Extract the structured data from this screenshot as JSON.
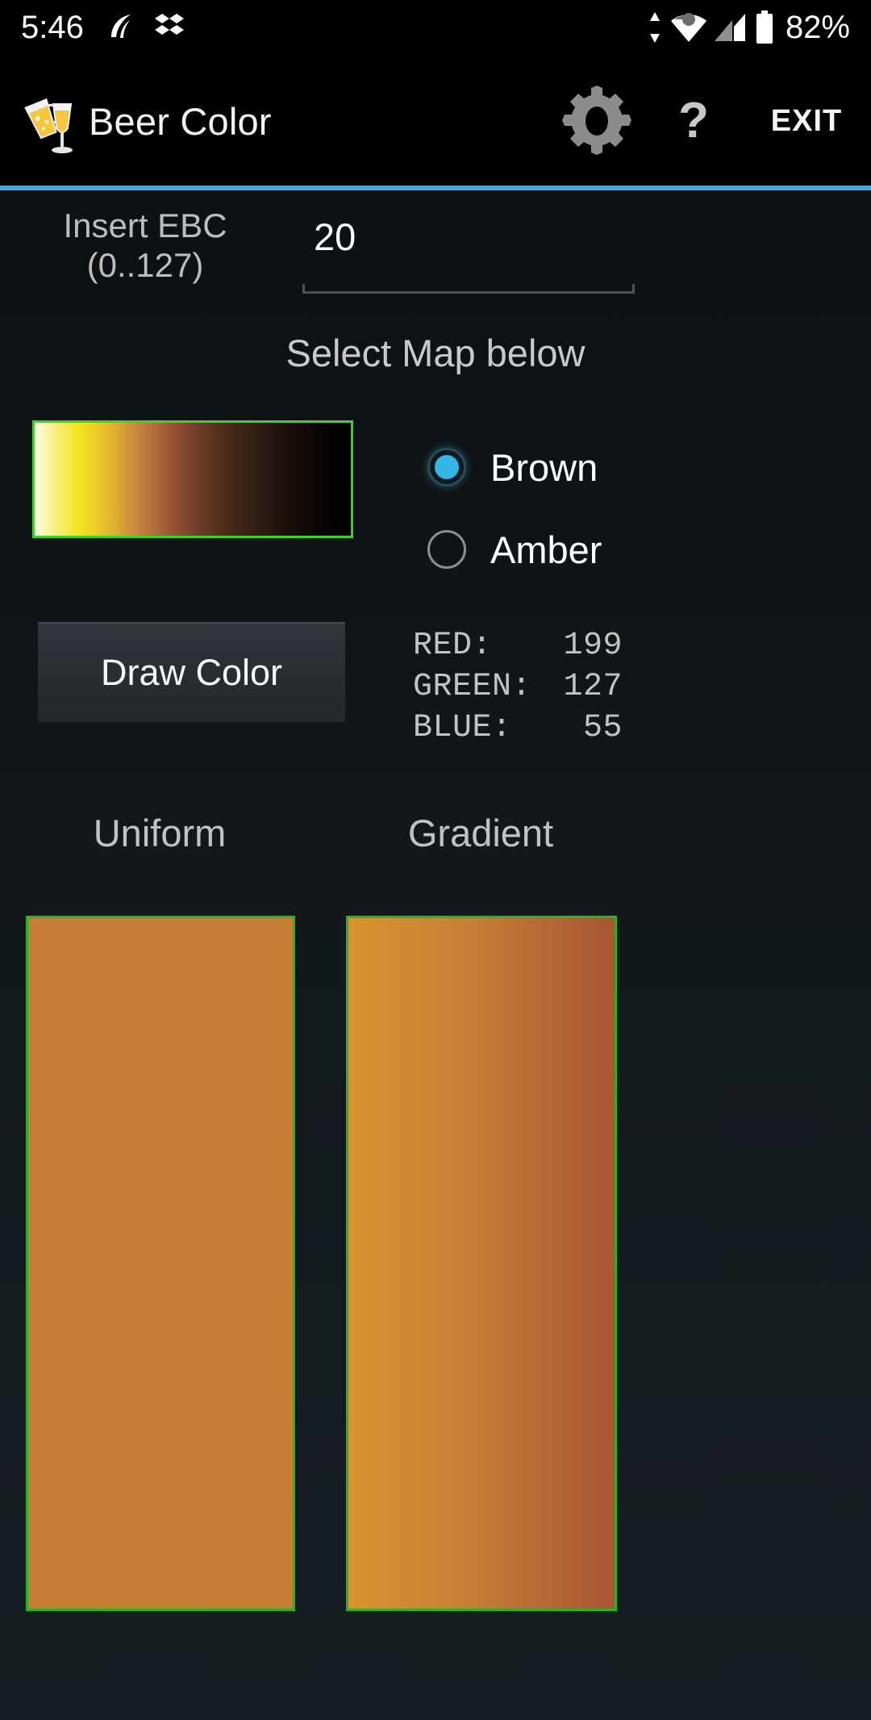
{
  "statusbar": {
    "time": "5:46",
    "battery_percent": "82%",
    "left_icons": [
      "swiftkey-icon",
      "dropbox-icon"
    ],
    "right_icons": [
      "sync-arrows-icon",
      "wifi-icon",
      "cellular-signal-icon",
      "battery-icon"
    ]
  },
  "appbar": {
    "app_icon": "beer-glasses-icon",
    "title": "Beer Color",
    "settings_icon": "gear-icon",
    "help_icon": "question-mark-icon",
    "exit_label": "EXIT",
    "accent_color": "#44a8dd"
  },
  "ebc": {
    "label_line1": "Insert EBC",
    "label_line2": "(0..127)",
    "value": "20",
    "placeholder": "0"
  },
  "map": {
    "section_title": "Select Map below",
    "swatch_border_color": "#3fd12a",
    "swatch_gradient_stops": [
      "#fdfbe8",
      "#f2e520",
      "#e7c22b",
      "#cf8e3c",
      "#a35d38",
      "#77402c",
      "#3b2317",
      "#1a100a",
      "#000000"
    ],
    "options": [
      {
        "label": "Brown",
        "selected": true
      },
      {
        "label": "Amber",
        "selected": false
      }
    ],
    "selected_color": "#33b5e5"
  },
  "draw": {
    "button_label": "Draw Color"
  },
  "rgb": {
    "red_key": "RED:",
    "red_value": "199",
    "green_key": "GREEN:",
    "green_value": "127",
    "blue_key": "BLUE:",
    "blue_value": "55",
    "resolved_hex": "#c77f37"
  },
  "panels": {
    "uniform_label": "Uniform",
    "gradient_label": "Gradient",
    "uniform_color": "#c77f37",
    "gradient_start": "#d9932f",
    "gradient_end": "#a85533",
    "border_color": "#23b523"
  }
}
